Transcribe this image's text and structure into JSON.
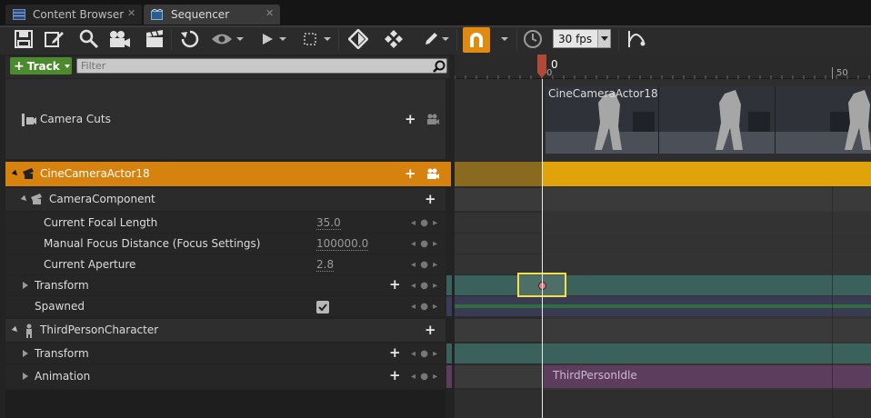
{
  "tabs": [
    {
      "label": "Content Browser",
      "icon": "content-browser-icon"
    },
    {
      "label": "Sequencer",
      "icon": "sequencer-icon"
    }
  ],
  "toolbar": {
    "icons": [
      "save-icon",
      "save-as-icon",
      "find-in-browser-icon",
      "camera-icon",
      "render-movie-icon",
      "undo-icon",
      "view-options-icon",
      "playback-icon",
      "selection-icon",
      "key-icon",
      "auto-key-icon",
      "edit-mode-icon",
      "snap-icon",
      "time-icon",
      "curve-editor-icon"
    ],
    "fps_value": "30 fps"
  },
  "filter": {
    "add_track_label": "Track",
    "placeholder": "Filter"
  },
  "timeline": {
    "ruler_zero": "0",
    "ruler_tick_zero": "0",
    "ruler_tick_fifty": "50"
  },
  "tracks": {
    "camera_cuts": "Camera Cuts",
    "camera_actor": "CineCameraActor18",
    "camera_component": "CameraComponent",
    "focal_length_label": "Current Focal Length",
    "focal_length_value": "35.0",
    "focus_distance_label": "Manual Focus Distance (Focus Settings)",
    "focus_distance_value": "100000.0",
    "aperture_label": "Current Aperture",
    "aperture_value": "2.8",
    "transform_label": "Transform",
    "spawned_label": "Spawned",
    "character": "ThirdPersonCharacter",
    "char_transform_label": "Transform",
    "animation_label": "Animation"
  },
  "sections": {
    "camera_cut_section": "CineCameraActor18",
    "animation_section": "ThirdPersonIdle"
  },
  "colors": {
    "selected_row": "#d6820f",
    "camera_track_bar": "#e2a20a",
    "transform_track": "#3a615c",
    "animation_track": "#5c3d5e",
    "spawned_line": "#2f6e3f",
    "add_track_button": "#4c8a2e",
    "snap_button": "#e08a10"
  }
}
